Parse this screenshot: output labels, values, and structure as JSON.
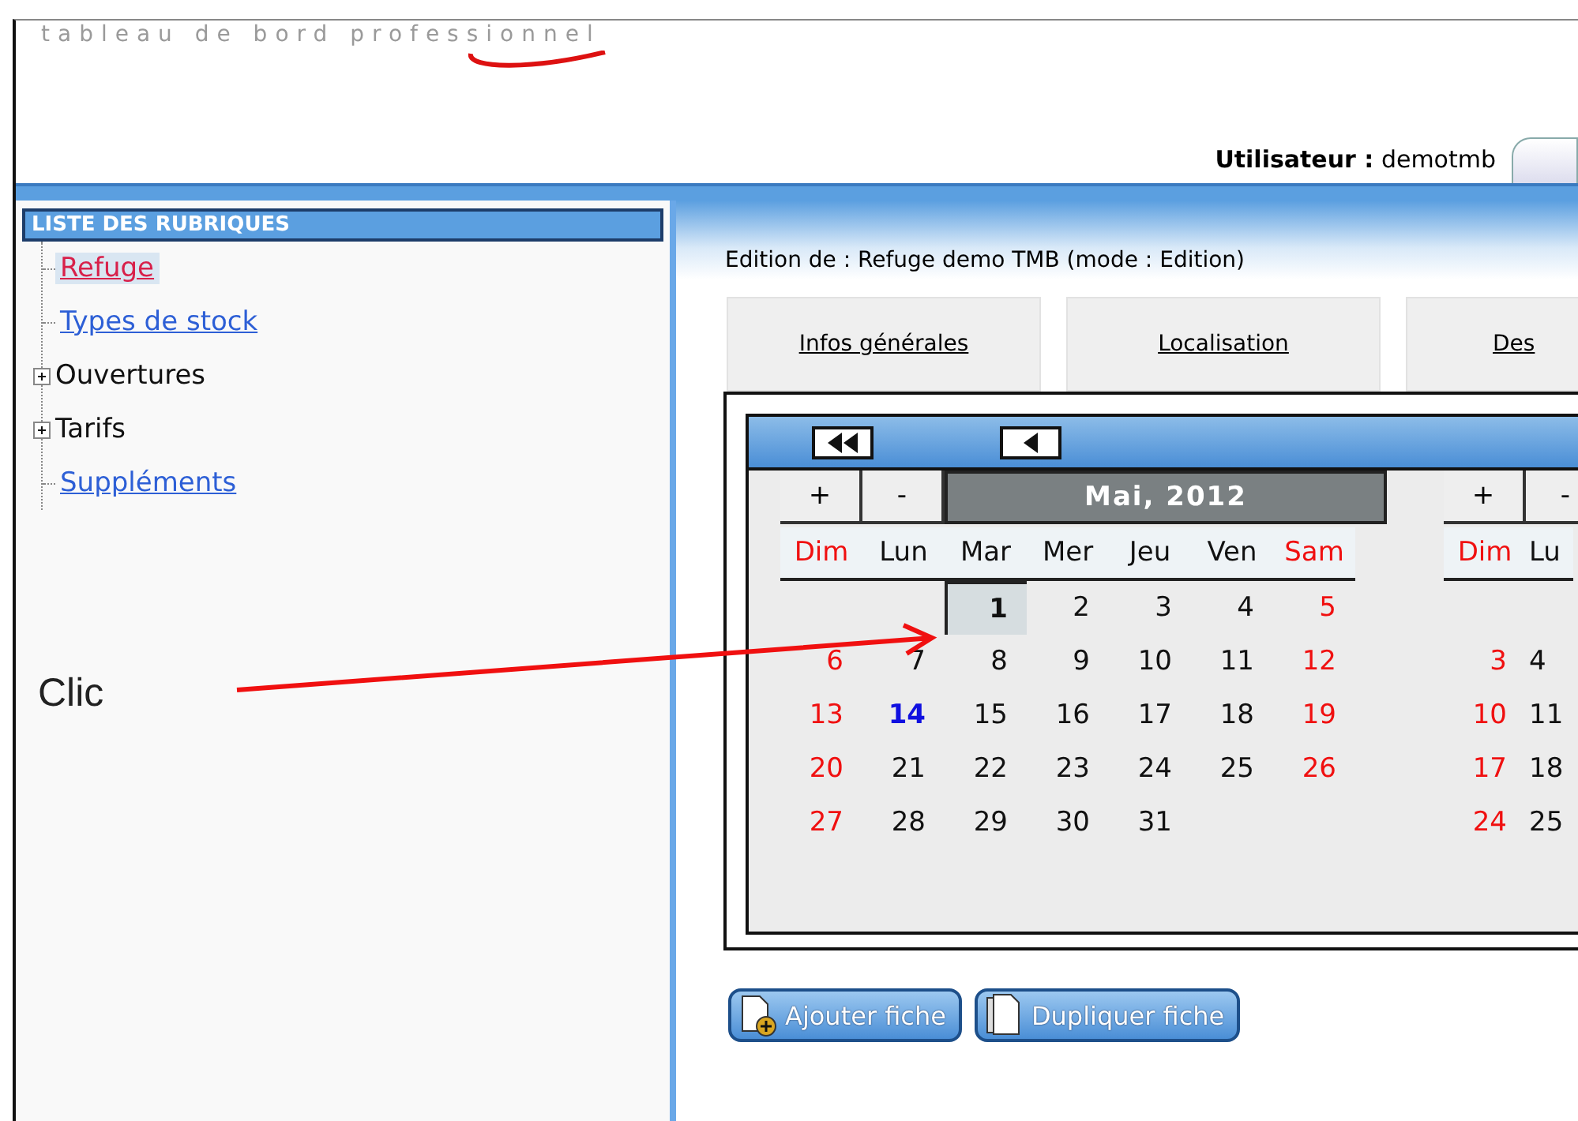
{
  "header": {
    "logo_text": "tableau de bord professionnel",
    "user_label": "Utilisateur :",
    "user_name": "demotmb"
  },
  "sidebar": {
    "title": "LISTE DES RUBRIQUES",
    "items": [
      {
        "label": "Refuge",
        "kind": "link",
        "selected": true
      },
      {
        "label": "Types de stock",
        "kind": "link",
        "selected": false
      },
      {
        "label": "Ouvertures",
        "kind": "folder",
        "expanded": false
      },
      {
        "label": "Tarifs",
        "kind": "folder",
        "expanded": false
      },
      {
        "label": "Suppléments",
        "kind": "link",
        "selected": false
      }
    ]
  },
  "annotation": {
    "text": "Clic"
  },
  "content": {
    "edit_title": "Edition de : Refuge demo TMB (mode : Edition)",
    "tabs": [
      {
        "label": "Infos générales",
        "selected": false
      },
      {
        "label": "Localisation",
        "selected": false
      },
      {
        "label": "Des",
        "selected": false
      }
    ],
    "calendars": [
      {
        "buttons": [
          "+",
          "-"
        ],
        "title": "Mai, 2012",
        "weekdays": [
          {
            "label": "Dim",
            "kind": "weekend"
          },
          {
            "label": "Lun",
            "kind": "weekday"
          },
          {
            "label": "Mar",
            "kind": "weekday"
          },
          {
            "label": "Mer",
            "kind": "weekday"
          },
          {
            "label": "Jeu",
            "kind": "weekday"
          },
          {
            "label": "Ven",
            "kind": "weekday"
          },
          {
            "label": "Sam",
            "kind": "weekend"
          }
        ],
        "weeks": [
          [
            {
              "kind": "blank"
            },
            {
              "kind": "blank"
            },
            {
              "text": "1",
              "kind": "weekday",
              "selected": true
            },
            {
              "text": "2",
              "kind": "weekday",
              "selected": false
            },
            {
              "text": "3",
              "kind": "weekday",
              "selected": false
            },
            {
              "text": "4",
              "kind": "weekday",
              "selected": false
            },
            {
              "text": "5",
              "kind": "weekend",
              "selected": false
            }
          ],
          [
            {
              "text": "6",
              "kind": "weekend",
              "selected": false
            },
            {
              "text": "7",
              "kind": "weekday",
              "selected": false
            },
            {
              "text": "8",
              "kind": "weekday",
              "selected": false
            },
            {
              "text": "9",
              "kind": "weekday",
              "selected": false
            },
            {
              "text": "10",
              "kind": "weekday",
              "selected": false
            },
            {
              "text": "11",
              "kind": "weekday",
              "selected": false
            },
            {
              "text": "12",
              "kind": "weekend",
              "selected": false
            }
          ],
          [
            {
              "text": "13",
              "kind": "weekend",
              "selected": false
            },
            {
              "text": "14",
              "kind": "today",
              "selected": false
            },
            {
              "text": "15",
              "kind": "weekday",
              "selected": false
            },
            {
              "text": "16",
              "kind": "weekday",
              "selected": false
            },
            {
              "text": "17",
              "kind": "weekday",
              "selected": false
            },
            {
              "text": "18",
              "kind": "weekday",
              "selected": false
            },
            {
              "text": "19",
              "kind": "weekend",
              "selected": false
            }
          ],
          [
            {
              "text": "20",
              "kind": "weekend",
              "selected": false
            },
            {
              "text": "21",
              "kind": "weekday",
              "selected": false
            },
            {
              "text": "22",
              "kind": "weekday",
              "selected": false
            },
            {
              "text": "23",
              "kind": "weekday",
              "selected": false
            },
            {
              "text": "24",
              "kind": "weekday",
              "selected": false
            },
            {
              "text": "25",
              "kind": "weekday",
              "selected": false
            },
            {
              "text": "26",
              "kind": "weekend",
              "selected": false
            }
          ],
          [
            {
              "text": "27",
              "kind": "weekend",
              "selected": false
            },
            {
              "text": "28",
              "kind": "weekday",
              "selected": false
            },
            {
              "text": "29",
              "kind": "weekday",
              "selected": false
            },
            {
              "text": "30",
              "kind": "weekday",
              "selected": false
            },
            {
              "text": "31",
              "kind": "weekday",
              "selected": false
            },
            {
              "kind": "blank"
            },
            {
              "kind": "blank"
            }
          ]
        ]
      },
      {
        "buttons": [
          "+",
          "-"
        ],
        "weekdays": [
          {
            "label": "Dim",
            "kind": "weekend"
          },
          {
            "label": "Lu",
            "kind": "weekday"
          }
        ],
        "weeks": [
          [
            {
              "kind": "blank"
            },
            {
              "kind": "blank"
            }
          ],
          [
            {
              "text": "3",
              "kind": "weekend",
              "selected": false
            },
            {
              "text": "4",
              "kind": "weekday",
              "selected": false
            }
          ],
          [
            {
              "text": "10",
              "kind": "weekend",
              "selected": false
            },
            {
              "text": "11",
              "kind": "weekday",
              "selected": false
            }
          ],
          [
            {
              "text": "17",
              "kind": "weekend",
              "selected": false
            },
            {
              "text": "18",
              "kind": "weekday",
              "selected": false
            }
          ],
          [
            {
              "text": "24",
              "kind": "weekend",
              "selected": false
            },
            {
              "text": "25",
              "kind": "weekday",
              "selected": false
            }
          ]
        ]
      }
    ]
  },
  "actions": [
    {
      "label": "Ajouter fiche",
      "kind": "add"
    },
    {
      "label": "Dupliquer fiche",
      "kind": "duplicate"
    }
  ]
}
